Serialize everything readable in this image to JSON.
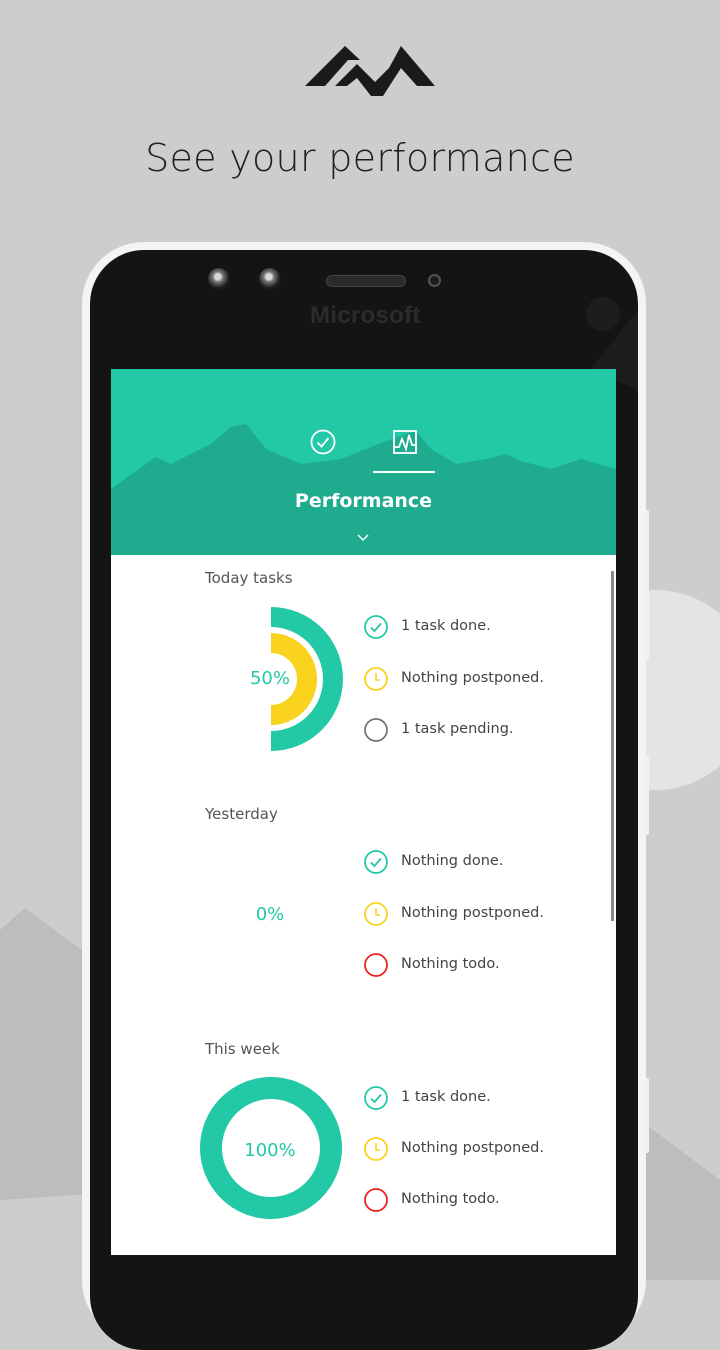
{
  "promo": {
    "headline": "See your performance",
    "logo_icon": "mountain-logo-icon"
  },
  "device": {
    "brand": "Microsoft"
  },
  "app": {
    "tabs": [
      {
        "name": "tasks",
        "icon": "check-circle-icon",
        "active": false
      },
      {
        "name": "performance",
        "icon": "activity-chart-icon",
        "active": true
      }
    ],
    "page_title": "Performance",
    "expand_icon": "chevron-down-icon",
    "colors": {
      "accent": "#23c8a6",
      "accent_dark": "#1fab8e",
      "postponed": "#f8d21c",
      "pending": "#757575",
      "todo": "#e52424"
    }
  },
  "sections": [
    {
      "title": "Today tasks",
      "percent_label": "50%",
      "done_fraction": 0.5,
      "postponed_fraction": 0.5,
      "stats": [
        {
          "icon": "check-circle-icon",
          "text": "1 task done."
        },
        {
          "icon": "clock-icon",
          "text": "Nothing postponed."
        },
        {
          "icon": "pending-circle-icon",
          "text": "1 task pending."
        }
      ]
    },
    {
      "title": "Yesterday",
      "percent_label": "0%",
      "done_fraction": 0,
      "stats": [
        {
          "icon": "check-circle-icon",
          "text": "Nothing done."
        },
        {
          "icon": "clock-icon",
          "text": "Nothing postponed."
        },
        {
          "icon": "todo-circle-icon",
          "text": "Nothing todo."
        }
      ]
    },
    {
      "title": "This week",
      "percent_label": "100%",
      "done_fraction": 1,
      "stats": [
        {
          "icon": "check-circle-icon",
          "text": "1 task done."
        },
        {
          "icon": "clock-icon",
          "text": "Nothing postponed."
        },
        {
          "icon": "todo-circle-icon",
          "text": "Nothing todo."
        }
      ]
    }
  ]
}
